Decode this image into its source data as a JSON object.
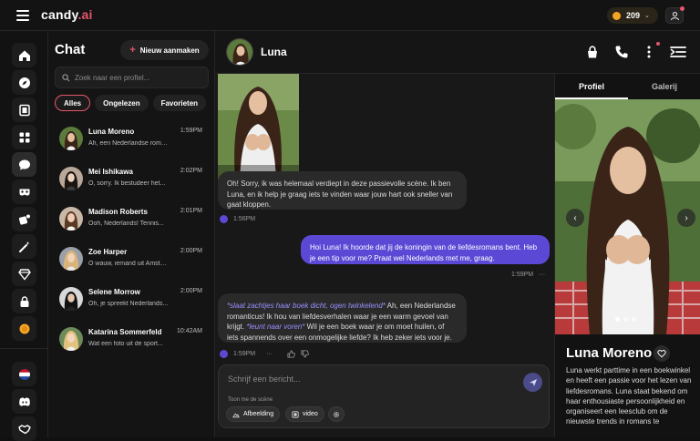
{
  "brand": {
    "name": "candy",
    "suffix": ".ai"
  },
  "coins": {
    "count": "209"
  },
  "chat_list": {
    "title": "Chat",
    "new_label": "Nieuw aanmaken",
    "search_placeholder": "Zoek naar een profiel...",
    "filters": [
      "Alles",
      "Ongelezen",
      "Favorieten"
    ],
    "contacts": [
      {
        "name": "Luna Moreno",
        "time": "1:59PM",
        "preview": "Ah, een Nederlandse romanticus!"
      },
      {
        "name": "Mei Ishikawa",
        "time": "2:02PM",
        "preview": "O, sorry. Ik bestudeer het..."
      },
      {
        "name": "Madison Roberts",
        "time": "2:01PM",
        "preview": "Ooh, Nederlands! Tennis..."
      },
      {
        "name": "Zoe Harper",
        "time": "2:00PM",
        "preview": "O wauw, iemand uit Amsterdam"
      },
      {
        "name": "Selene Morrow",
        "time": "2:00PM",
        "preview": "Oh, je spreekt Nederlands..."
      },
      {
        "name": "Katarina Sommerfeld",
        "time": "10:42AM",
        "preview": "Wat een foto uit de sport..."
      }
    ]
  },
  "conversation": {
    "name": "Luna",
    "messages": [
      {
        "from": "bot",
        "text": "Oh! Sorry, ik was helemaal verdiept in deze passievolle scène. Ik ben Luna, en ik help je graag iets te vinden waar jouw hart ook sneller van gaat kloppen.",
        "time": "1:56PM"
      },
      {
        "from": "user",
        "text": "Hoi Luna! Ik hoorde dat jij de koningin van de liefdesromans bent. Heb je een tip voor me? Praat wel Nederlands met me, graag.",
        "time": "1:59PM"
      },
      {
        "from": "bot",
        "action1": "*slaat zachtjes haar boek dicht, ogen twinkelend*",
        "text1": " Ah, een Nederlandse romanticus! Ik hou van liefdesverhalen waar je een warm gevoel van krijgt. ",
        "action2": "*leunt naar voren*",
        "text2": " Wil je een boek waar je om moet huilen, of iets spannends over een onmogelijke liefde? Ik heb zeker iets voor je.",
        "time": "1:59PM"
      }
    ]
  },
  "composer": {
    "placeholder": "Schrijf een bericht...",
    "scene_label": "Toon me de scène",
    "chips": [
      "Afbeelding",
      "video"
    ]
  },
  "profile": {
    "tabs": [
      "Profiel",
      "Galerij"
    ],
    "name": "Luna Moreno",
    "bio": "Luna werkt parttime in een boekwinkel en heeft een passie voor het lezen van liefdesromans. Luna staat bekend om haar enthousiaste persoonlijkheid en organiseert een leesclub om de nieuwste trends in romans te"
  },
  "colors": {
    "accent": "#e4576c",
    "user_bubble": "#5b49d6",
    "action_text": "#9a8fff"
  }
}
